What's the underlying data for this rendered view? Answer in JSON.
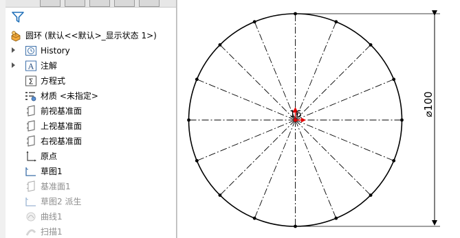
{
  "window": {
    "accent": "#1e73be"
  },
  "tree": {
    "filter_icon": "filter-icon",
    "root": {
      "label": "圆环 (默认<<默认>_显示状态 1>)",
      "icon": "part-icon"
    },
    "items": [
      {
        "label": "History",
        "icon": "history-icon",
        "expandable": true,
        "dimmed": false
      },
      {
        "label": "注解",
        "icon": "annotations-icon",
        "expandable": true,
        "dimmed": false
      },
      {
        "label": "方程式",
        "icon": "equations-icon",
        "expandable": false,
        "dimmed": false
      },
      {
        "label": "材质 <未指定>",
        "icon": "material-icon",
        "expandable": false,
        "dimmed": false
      },
      {
        "label": "前视基准面",
        "icon": "plane-icon",
        "expandable": false,
        "dimmed": false
      },
      {
        "label": "上视基准面",
        "icon": "plane-icon",
        "expandable": false,
        "dimmed": false
      },
      {
        "label": "右视基准面",
        "icon": "plane-icon",
        "expandable": false,
        "dimmed": false
      },
      {
        "label": "原点",
        "icon": "origin-icon",
        "expandable": false,
        "dimmed": false
      },
      {
        "label": "草图1",
        "icon": "sketch-icon",
        "expandable": false,
        "dimmed": false
      },
      {
        "label": "基准面1",
        "icon": "plane-icon",
        "expandable": false,
        "dimmed": true
      },
      {
        "label": "草图2 派生",
        "icon": "sketch-icon",
        "expandable": false,
        "dimmed": true
      },
      {
        "label": "曲线1",
        "icon": "curve-icon",
        "expandable": false,
        "dimmed": true
      },
      {
        "label": "扫描1",
        "icon": "sweep-icon",
        "expandable": false,
        "dimmed": true
      }
    ]
  },
  "sketch": {
    "dimension_text": "⌀100",
    "count_label": "16",
    "divisions": 16,
    "line_color": "#000000",
    "axis_colors": {
      "x": "#e00000",
      "y": "#e00000"
    }
  }
}
